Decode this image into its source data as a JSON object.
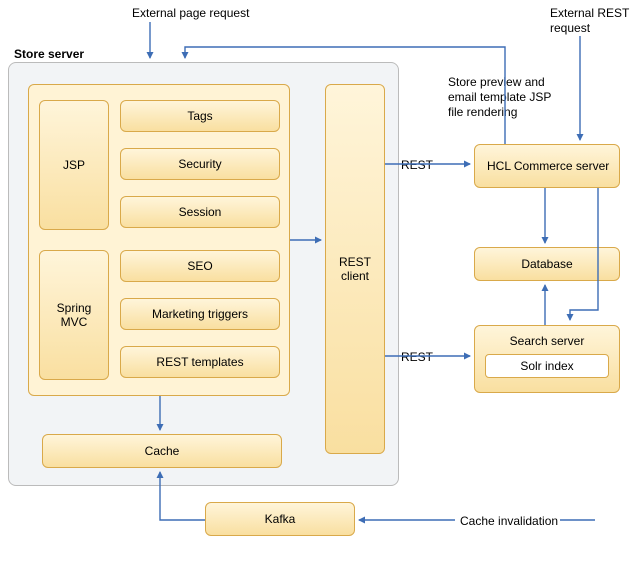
{
  "labels": {
    "external_page_request": "External page request",
    "external_rest_request": "External REST request",
    "store_preview": "Store preview and email template JSP file rendering",
    "rest1": "REST",
    "rest2": "REST",
    "cache_invalidation": "Cache invalidation"
  },
  "store_server": {
    "title": "Store server",
    "jsp": "JSP",
    "spring_mvc": "Spring MVC",
    "tags": "Tags",
    "security": "Security",
    "session": "Session",
    "seo": "SEO",
    "marketing_triggers": "Marketing triggers",
    "rest_templates": "REST templates",
    "rest_client": "REST client",
    "cache": "Cache"
  },
  "right": {
    "hcl": "HCL Commerce server",
    "database": "Database",
    "search_server": "Search server",
    "solr_index": "Solr index"
  },
  "bottom": {
    "kafka": "Kafka"
  }
}
